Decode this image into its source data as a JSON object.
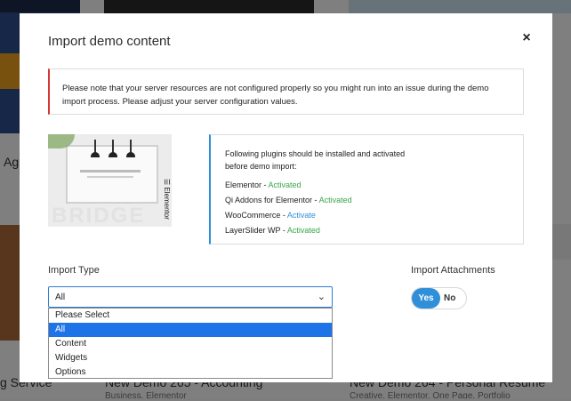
{
  "background": {
    "card_left_title_fragment": "Ag",
    "card_bottom_left_title": "g Service",
    "card_middle_title": "New Demo 265 - Accounting",
    "card_middle_tags": "Business, Elementor",
    "card_right_title": "New Demo 264 - Personal Resume",
    "card_right_tags": "Creative, Elementor, One Page, Portfolio"
  },
  "modal": {
    "title": "Import demo content",
    "close_label": "×",
    "notice": "Please note that your server resources are not configured properly so you might run into an issue during the demo import process. Please adjust your server configuration values.",
    "preview_label": "Elementor",
    "preview_text": "BRIDGE",
    "plugins_intro": "Following plugins should be installed and activated before demo import:",
    "plugins": [
      {
        "name": "Elementor - ",
        "status": "Activated",
        "status_type": "activated"
      },
      {
        "name": "Qi Addons for Elementor - ",
        "status": "Activated",
        "status_type": "activated"
      },
      {
        "name": "WooCommerce - ",
        "status": "Activate",
        "status_type": "activate"
      },
      {
        "name": "LayerSlider WP - ",
        "status": "Activated",
        "status_type": "activated"
      }
    ],
    "import_type_label": "Import Type",
    "import_type_value": "All",
    "import_type_options": [
      "Please Select",
      "All",
      "Content",
      "Widgets",
      "Options"
    ],
    "selected_option_index": 1,
    "attachments_label": "Import Attachments",
    "attachments_yes": "Yes",
    "attachments_no": "No",
    "attachments_value": "Yes"
  },
  "colors": {
    "accent": "#2f8fd8",
    "notice_border": "#d63638",
    "activated": "#3aa54a",
    "selected_option": "#1e73e8"
  }
}
